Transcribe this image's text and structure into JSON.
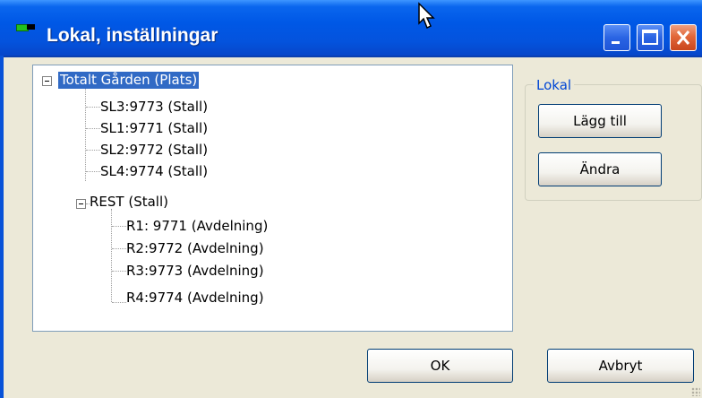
{
  "window": {
    "title": "Lokal, inställningar",
    "accent": "#0058E6",
    "controls": {
      "minimize": "minimize-icon",
      "maximize": "maximize-icon",
      "close": "close-icon"
    }
  },
  "tree": {
    "root": "Totalt Gården (Plats)",
    "stalls": [
      "SL3:9773 (Stall)",
      "SL1:9771 (Stall)",
      "SL2:9772 (Stall)",
      "SL4:9774 (Stall)"
    ],
    "rest": "REST (Stall)",
    "departments": [
      "R1: 9771 (Avdelning)",
      "R2:9772 (Avdelning)",
      "R3:9773 (Avdelning)",
      "R4:9774 (Avdelning)"
    ]
  },
  "lokal_group": {
    "label": "Lokal",
    "add_button": "Lägg till",
    "edit_button": "Ändra"
  },
  "footer": {
    "ok_button": "OK",
    "cancel_button": "Avbryt"
  }
}
